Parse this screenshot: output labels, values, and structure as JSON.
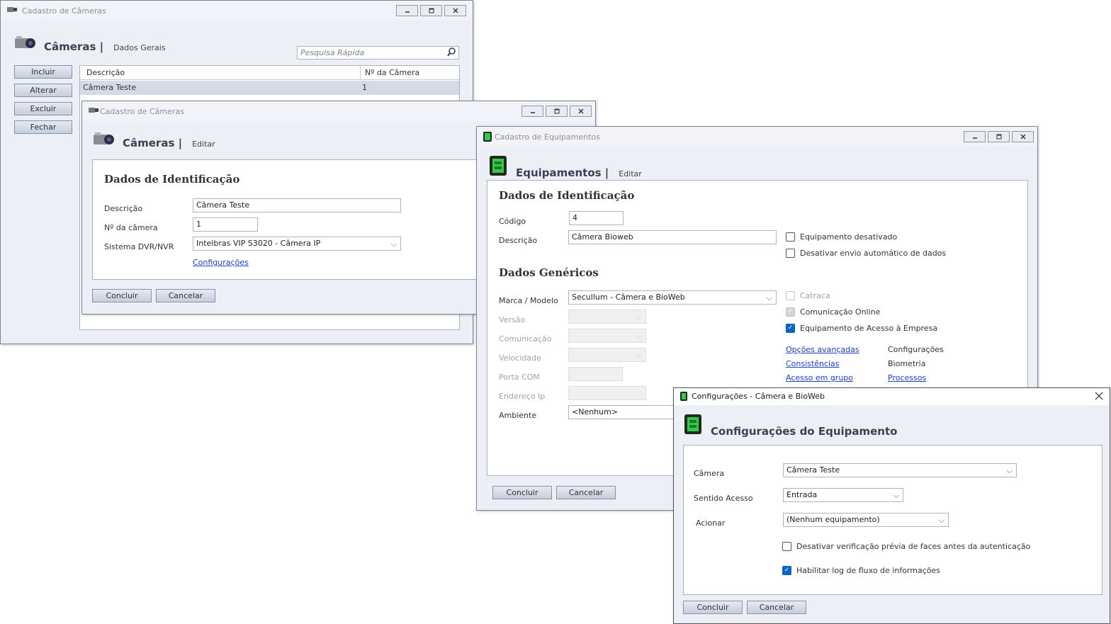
{
  "window1": {
    "title": "Cadastro de Câmeras",
    "header_title": "Câmeras |",
    "header_sub": "Dados Gerais",
    "search_placeholder": "Pesquisa Rápida",
    "buttons": [
      "Incluir",
      "Alterar",
      "Excluir",
      "Fechar"
    ],
    "table": {
      "columns": [
        "Descrição",
        "Nº da Câmera"
      ],
      "rows": [
        [
          "Câmera Teste",
          "1"
        ]
      ]
    }
  },
  "window2": {
    "title": "Cadastro de Câmeras",
    "header_title": "Câmeras |",
    "header_sub": "Editar",
    "section": "Dados de Identificação",
    "fields": {
      "descricao_label": "Descrição",
      "descricao_value": "Câmera Teste",
      "numero_label": "Nº da câmera",
      "numero_value": "1",
      "sistema_label": "Sistema DVR/NVR",
      "sistema_value": "Intelbras VIP S3020 - Câmera IP"
    },
    "link": "Configurações",
    "buttons": {
      "ok": "Concluir",
      "cancel": "Cancelar"
    }
  },
  "window3": {
    "title": "Cadastro de Equipamentos",
    "header_title": "Equipamentos |",
    "header_sub": "Editar",
    "section1": "Dados de Identificação",
    "codigo_label": "Código",
    "codigo_value": "4",
    "descricao_label": "Descrição",
    "descricao_value": "Câmera Bioweb",
    "chk_desativado": "Equipamento desativado",
    "chk_envio": "Desativar envio automático de dados",
    "section2": "Dados Genéricos",
    "marca_label": "Marca / Modelo",
    "marca_value": "Secullum - Câmera e BioWeb",
    "versao_label": "Versão",
    "comunicacao_label": "Comunicação",
    "velocidade_label": "Velocidade",
    "porta_label": "Porta COM",
    "endereco_label": "Endereço Ip",
    "ambiente_label": "Ambiente",
    "ambiente_value": "<Nenhum>",
    "chk_catraca": "Catraca",
    "chk_online": "Comunicação Online",
    "chk_acesso": "Equipamento de Acesso à Empresa",
    "links": {
      "opcoes": "Opções avançadas",
      "consistencias": "Consistências",
      "acesso_grupo": "Acesso em grupo",
      "processos": "Processos"
    },
    "texts": {
      "configuracoes": "Configurações",
      "biometria": "Biometria"
    },
    "buttons": {
      "ok": "Concluir",
      "cancel": "Cancelar"
    }
  },
  "window4": {
    "title": "Configurações - Câmera e BioWeb",
    "header_title": "Configurações do Equipamento",
    "camera_label": "Câmera",
    "camera_value": "Câmera Teste",
    "sentido_label": "Sentido Acesso",
    "sentido_value": "Entrada",
    "acionar_label": "Acionar",
    "acionar_value": "(Nenhum equipamento)",
    "chk_faces": "Desativar verificação prévia de faces antes da autenticação",
    "chk_log": "Habilitar log de fluxo de informações",
    "buttons": {
      "ok": "Concluir",
      "cancel": "Cancelar"
    }
  },
  "colors": {
    "link": "#1a3fd1",
    "check_accent": "#0a63c8",
    "title_text": "#394355",
    "selection": "#d4dbe8"
  }
}
